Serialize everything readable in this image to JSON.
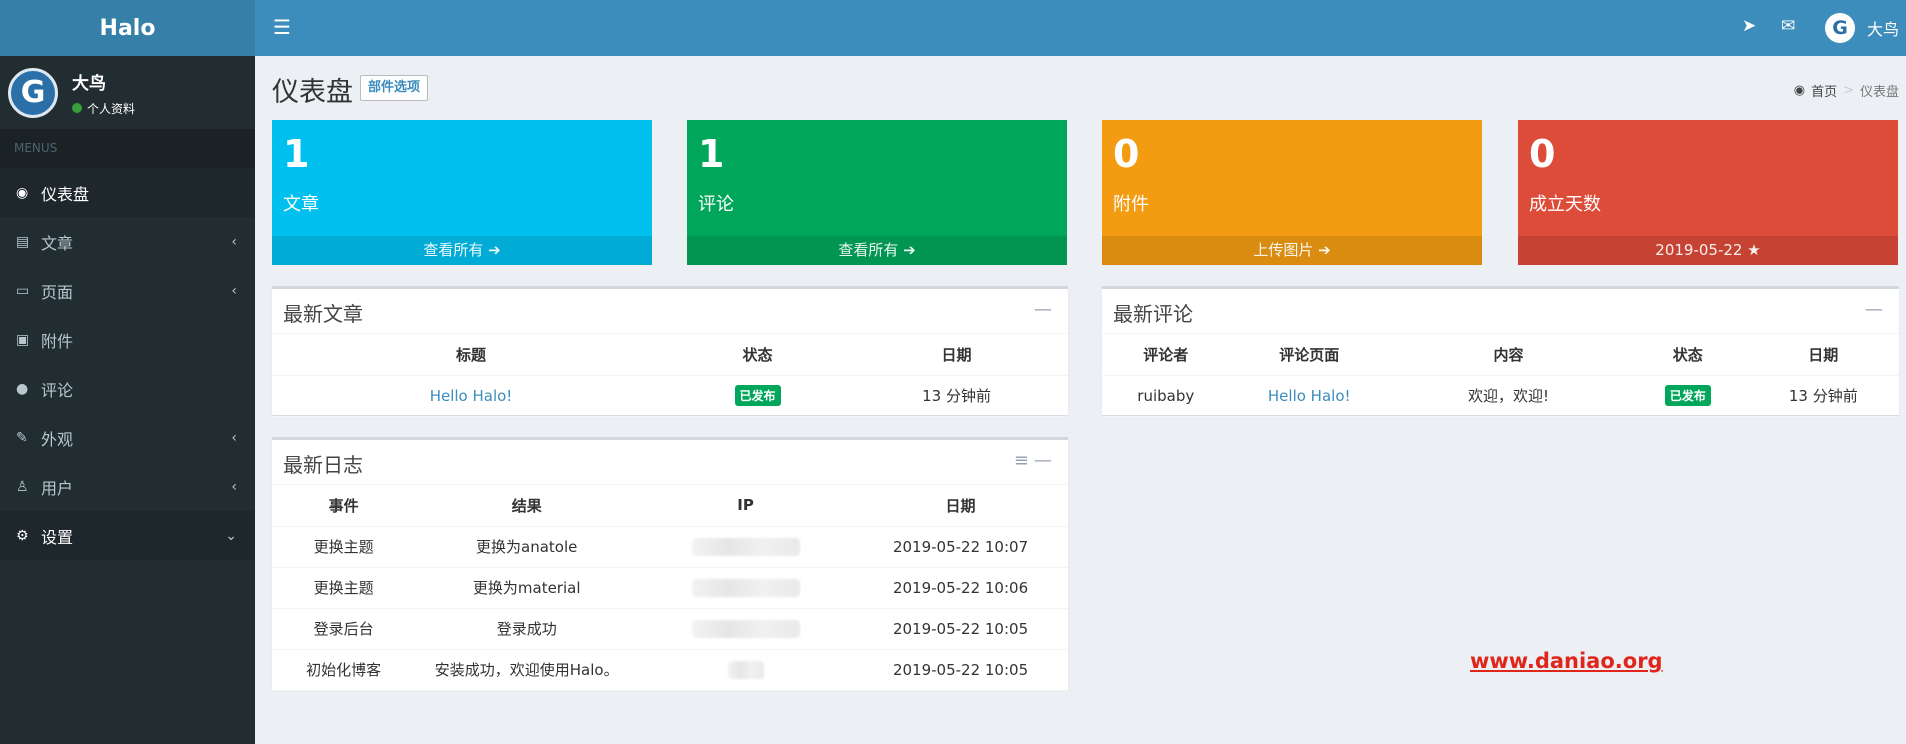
{
  "app": {
    "logo": "Halo"
  },
  "user": {
    "name": "大鸟",
    "status": "个人资料",
    "avatar_letter": "G"
  },
  "sidebar": {
    "header": "MENUS",
    "items": [
      {
        "label": "仪表盘",
        "icon": "dashboard-icon",
        "glyph": "◉",
        "active": true,
        "arrow": ""
      },
      {
        "label": "文章",
        "icon": "book-icon",
        "glyph": "▤",
        "active": false,
        "arrow": "‹"
      },
      {
        "label": "页面",
        "icon": "desktop-icon",
        "glyph": "▭",
        "active": false,
        "arrow": "‹"
      },
      {
        "label": "附件",
        "icon": "image-icon",
        "glyph": "▣",
        "active": false,
        "arrow": ""
      },
      {
        "label": "评论",
        "icon": "comment-icon",
        "glyph": "●",
        "active": false,
        "arrow": ""
      },
      {
        "label": "外观",
        "icon": "brush-icon",
        "glyph": "✎",
        "active": false,
        "arrow": "‹"
      },
      {
        "label": "用户",
        "icon": "user-icon",
        "glyph": "♙",
        "active": false,
        "arrow": "‹"
      },
      {
        "label": "设置",
        "icon": "gear-icon",
        "glyph": "⚙",
        "active": true,
        "arrow": "⌄"
      }
    ]
  },
  "navbar": {
    "user_name": "大鸟",
    "avatar_letter": "G"
  },
  "header": {
    "title": "仪表盘",
    "widget_button": "部件选项",
    "breadcrumb_home": "首页",
    "breadcrumb_current": "仪表盘"
  },
  "stats": [
    {
      "value": "1",
      "label": "文章",
      "footer": "查看所有 ➔",
      "color": "#00c0ef"
    },
    {
      "value": "1",
      "label": "评论",
      "footer": "查看所有 ➔",
      "color": "#00a65a"
    },
    {
      "value": "0",
      "label": "附件",
      "footer": "上传图片 ➔",
      "color": "#f39c12"
    },
    {
      "value": "0",
      "label": "成立天数",
      "footer": "2019-05-22 ★",
      "color": "#dd4b39"
    }
  ],
  "latest_posts": {
    "title": "最新文章",
    "columns": [
      "标题",
      "状态",
      "日期"
    ],
    "rows": [
      {
        "title": "Hello Halo!",
        "status": "已发布",
        "date": "13 分钟前"
      }
    ]
  },
  "latest_comments": {
    "title": "最新评论",
    "columns": [
      "评论者",
      "评论页面",
      "内容",
      "状态",
      "日期"
    ],
    "rows": [
      {
        "author": "ruibaby",
        "page": "Hello Halo!",
        "content": "欢迎，欢迎!",
        "status": "已发布",
        "date": "13 分钟前"
      }
    ]
  },
  "latest_logs": {
    "title": "最新日志",
    "columns": [
      "事件",
      "结果",
      "IP",
      "日期"
    ],
    "rows": [
      {
        "event": "更换主题",
        "result": "更换为anatole",
        "date": "2019-05-22 10:07"
      },
      {
        "event": "更换主题",
        "result": "更换为material",
        "date": "2019-05-22 10:06"
      },
      {
        "event": "登录后台",
        "result": "登录成功",
        "date": "2019-05-22 10:05"
      },
      {
        "event": "初始化博客",
        "result": "安装成功，欢迎使用Halo。",
        "date": "2019-05-22 10:05"
      }
    ]
  },
  "watermark": "www.daniao.org"
}
